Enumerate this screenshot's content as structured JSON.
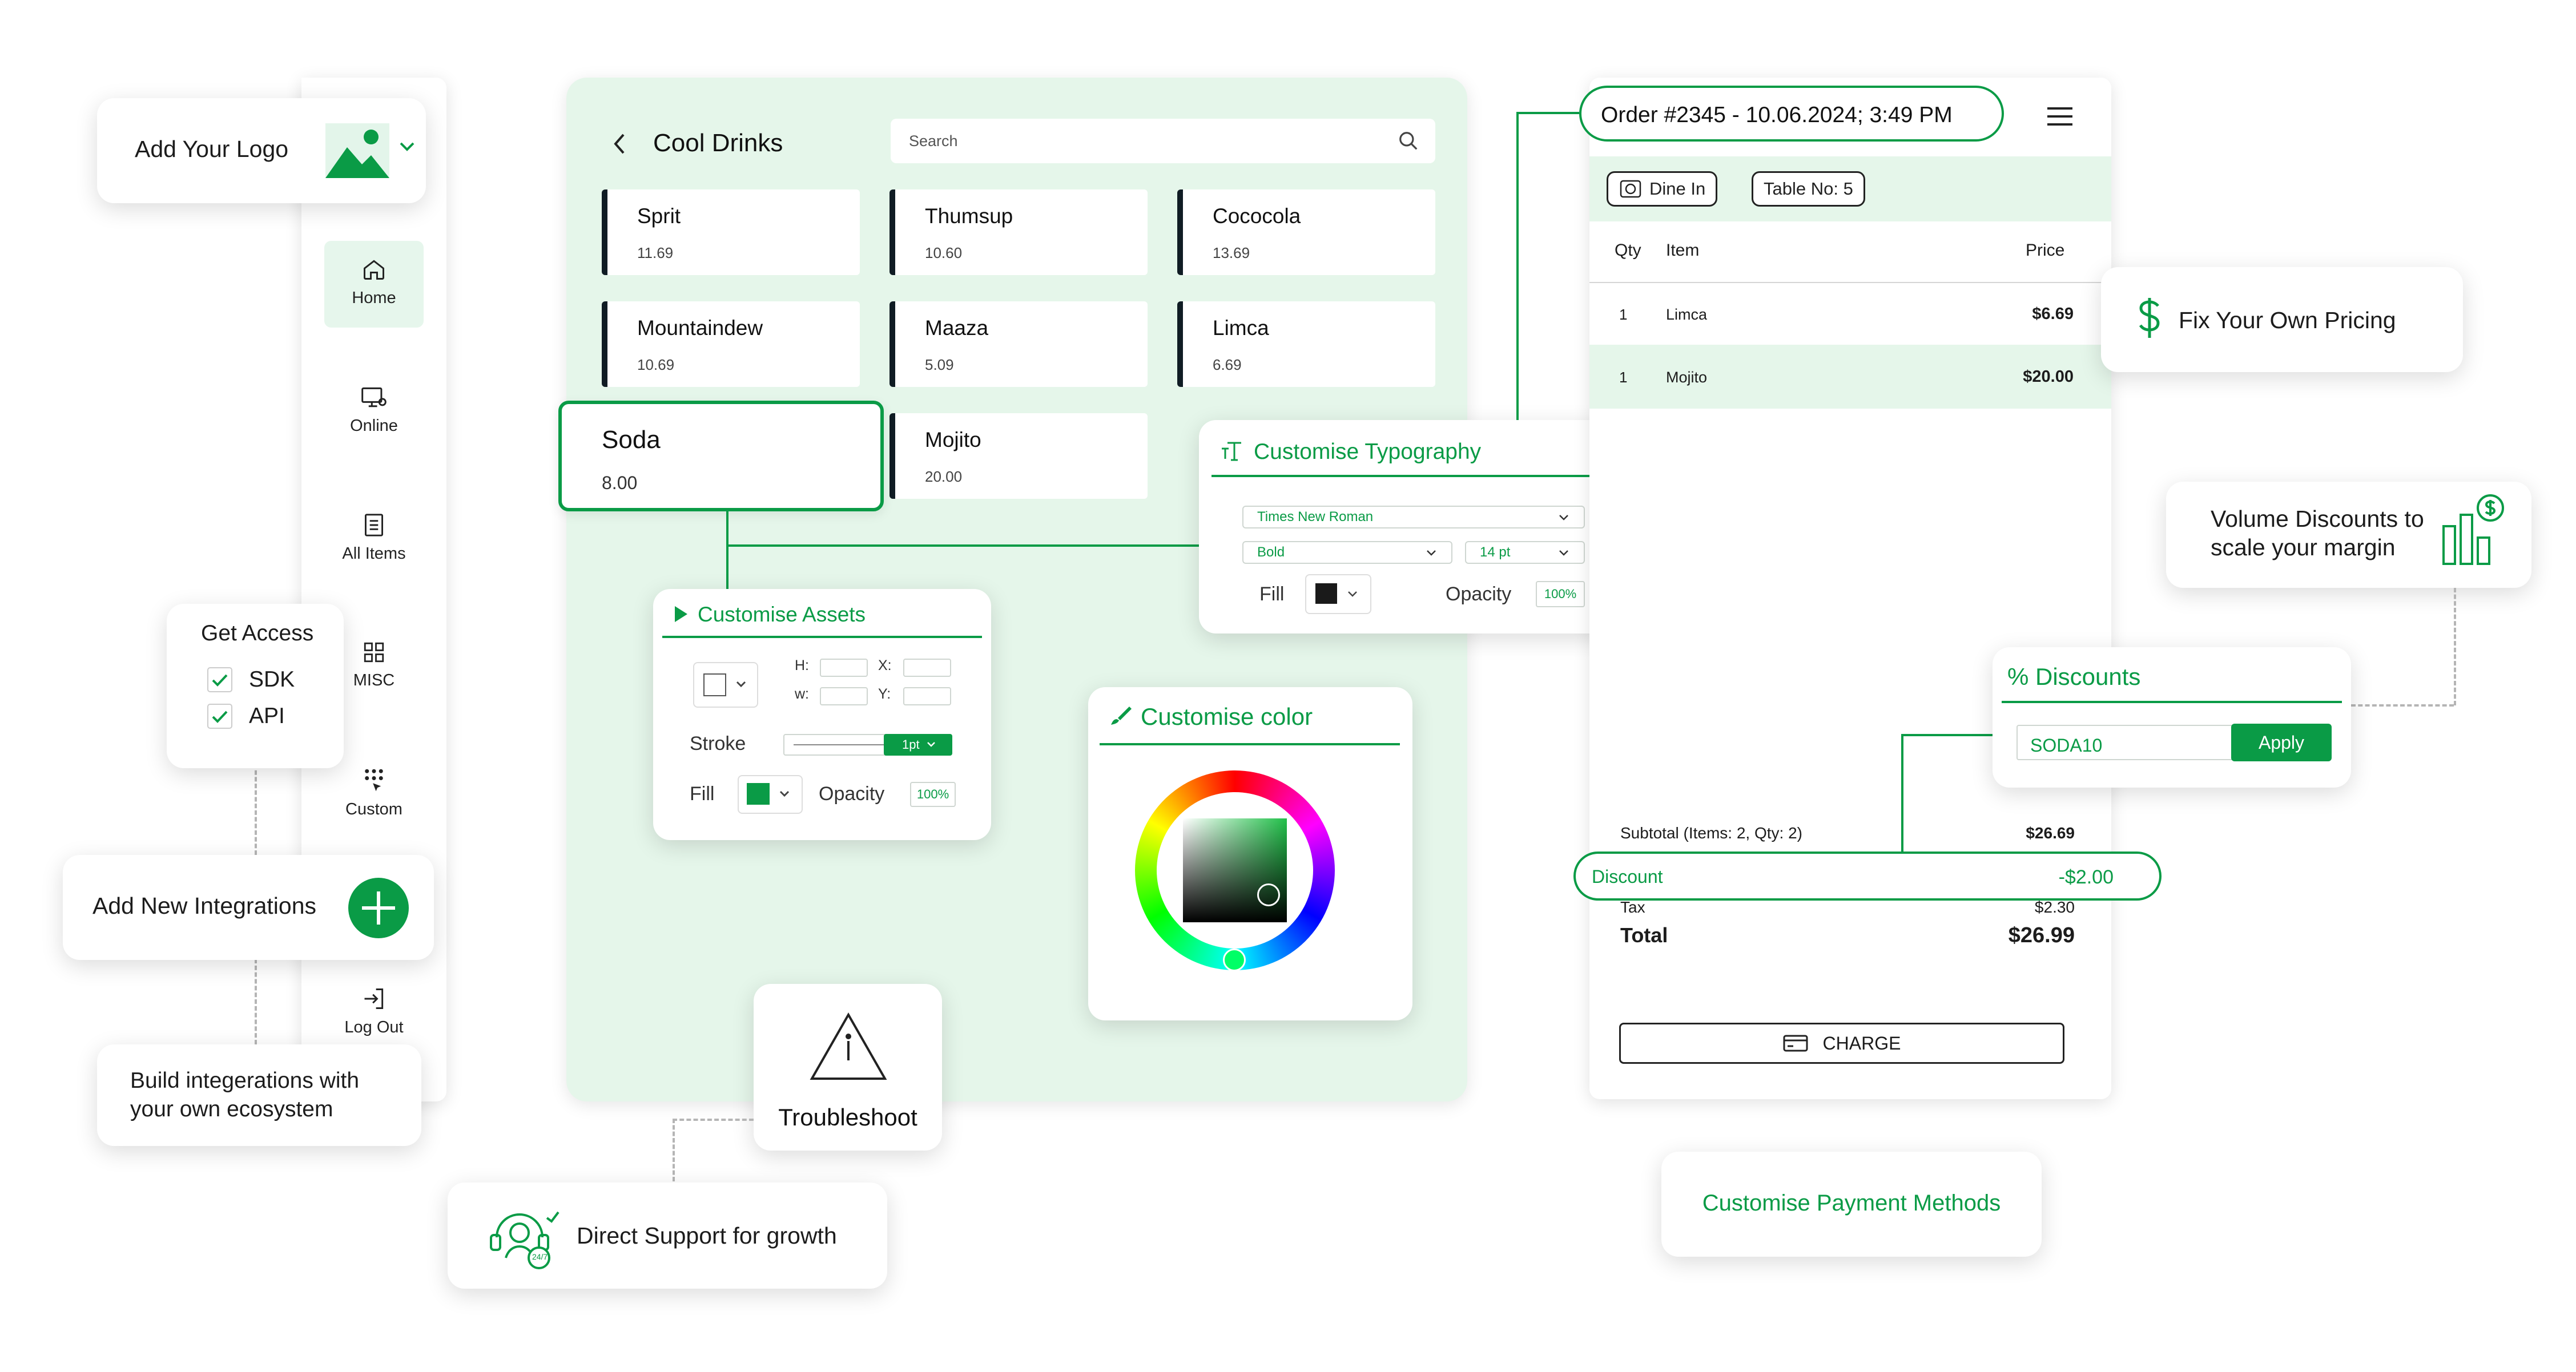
{
  "logo_card": {
    "label": "Add Your Logo"
  },
  "sidebar": {
    "items": [
      {
        "label": "Home",
        "icon": "home-icon"
      },
      {
        "label": "Online",
        "icon": "monitor-icon"
      },
      {
        "label": "All Items",
        "icon": "list-icon"
      },
      {
        "label": "MISC",
        "icon": "grid-icon"
      },
      {
        "label": "Custom",
        "icon": "custom-grid-icon"
      },
      {
        "label": "Log Out",
        "icon": "logout-icon"
      }
    ]
  },
  "access_card": {
    "title": "Get Access",
    "options": [
      "SDK",
      "API"
    ]
  },
  "integrations_card": {
    "label": "Add New Integrations"
  },
  "build_card": {
    "line1": "Build integerations with",
    "line2": "your own ecosystem"
  },
  "pos": {
    "title": "Cool Drinks",
    "search_placeholder": "Search",
    "items": [
      {
        "name": "Sprit",
        "price": "11.69"
      },
      {
        "name": "Thumsup",
        "price": "10.60"
      },
      {
        "name": "Cococola",
        "price": "13.69"
      },
      {
        "name": "Mountaindew",
        "price": "10.69"
      },
      {
        "name": "Maaza",
        "price": "5.09"
      },
      {
        "name": "Limca",
        "price": "6.69"
      },
      {
        "name": "Soda",
        "price": "8.00"
      },
      {
        "name": "Mojito",
        "price": "20.00"
      }
    ]
  },
  "assets_panel": {
    "title": "Customise Assets",
    "h_label": "H:",
    "w_label": "w:",
    "x_label": "X:",
    "y_label": "Y:",
    "stroke_label": "Stroke",
    "stroke_value": "1pt",
    "fill_label": "Fill",
    "opacity_label": "Opacity",
    "opacity_value": "100%"
  },
  "typography_panel": {
    "title": "Customise Typography",
    "font": "Times New Roman",
    "weight": "Bold",
    "size": "14 pt",
    "fill_label": "Fill",
    "opacity_label": "Opacity",
    "opacity_value": "100%"
  },
  "color_panel": {
    "title": "Customise color"
  },
  "troubleshoot": {
    "label": "Troubleshoot"
  },
  "support_card": {
    "label": "Direct Support for growth",
    "badge": "24/7"
  },
  "order": {
    "header": "Order #2345 - 10.06.2024; 3:49 PM",
    "dine_in": "Dine In",
    "table": "Table No: 5",
    "columns": {
      "qty": "Qty",
      "item": "Item",
      "price": "Price"
    },
    "rows": [
      {
        "qty": "1",
        "item": "Limca",
        "price": "$6.69"
      },
      {
        "qty": "1",
        "item": "Mojito",
        "price": "$20.00"
      }
    ],
    "subtotal_label": "Subtotal (Items: 2, Qty: 2)",
    "subtotal_value": "$26.69",
    "discount_label": "Discount",
    "discount_value": "-$2.00",
    "tax_label": "Tax",
    "tax_value": "$2.30",
    "total_label": "Total",
    "total_value": "$26.99",
    "charge_label": "CHARGE"
  },
  "pricing_card": {
    "label": "Fix Your Own Pricing"
  },
  "volume_card": {
    "line1": "Volume Discounts to",
    "line2": "scale your margin"
  },
  "discount_card": {
    "title": "% Discounts",
    "code": "SODA10",
    "apply": "Apply"
  },
  "payment_card": {
    "label": "Customise Payment Methods"
  },
  "colors": {
    "brand_green": "#0a9b46",
    "panel_mint": "#e5f6ea",
    "dark": "#101c24"
  }
}
